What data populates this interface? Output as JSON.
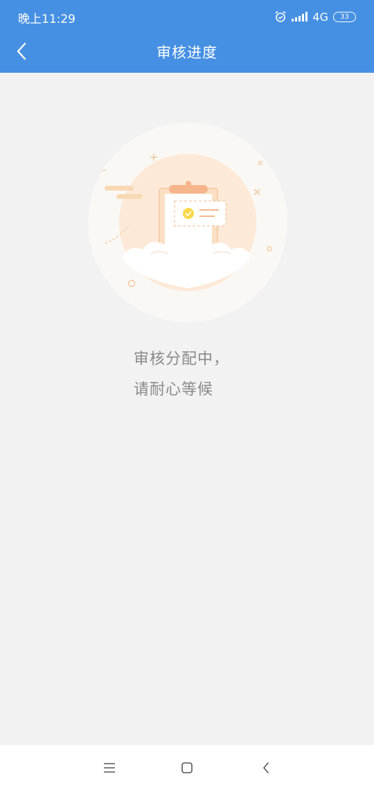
{
  "status_bar": {
    "time": "晚上11:29",
    "network": "4G",
    "battery": "33",
    "icons": [
      "alarm-icon",
      "signal-icon",
      "battery-icon"
    ]
  },
  "header": {
    "title": "审核进度",
    "back_icon": "chevron-left-icon",
    "background_color": "#4690e3"
  },
  "main": {
    "illustration": "clipboard-review-illustration",
    "message_line1": "审核分配中，",
    "message_line2": "请耐心等候"
  },
  "system_nav": {
    "icons": [
      "menu-icon",
      "home-icon",
      "back-icon"
    ]
  }
}
